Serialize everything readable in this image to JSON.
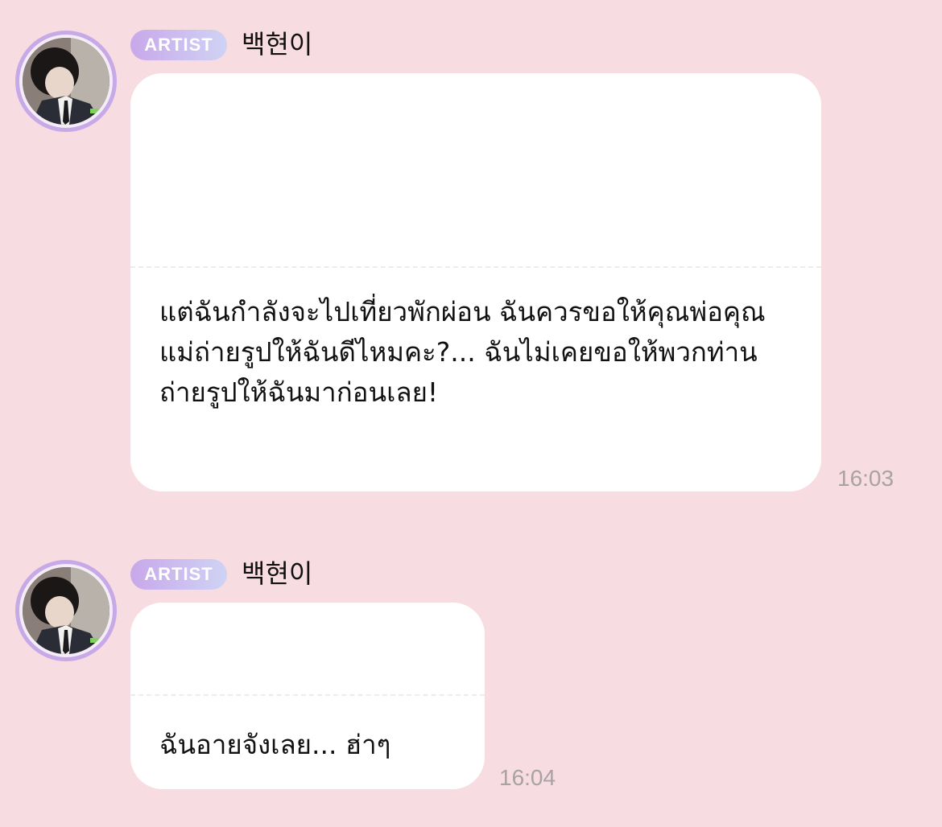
{
  "messages": [
    {
      "badge": "ARTIST",
      "sender": "백현이",
      "text": "แต่ฉันกำลังจะไปเที่ยวพักผ่อน ฉันควรขอให้คุณพ่อคุณแม่ถ่ายรูปให้ฉันดีไหมคะ?... ฉันไม่เคยขอให้พวกท่านถ่ายรูปให้ฉันมาก่อนเลย!",
      "time": "16:03"
    },
    {
      "badge": "ARTIST",
      "sender": "백현이",
      "text": "ฉันอายจังเลย... ฮ่าๆ",
      "time": "16:04"
    }
  ],
  "colors": {
    "background": "#f7dce1",
    "bubble": "#ffffff",
    "badge_gradient_start": "#c8a8ea",
    "badge_gradient_end": "#cfd3f4",
    "avatar_ring": "#c6a9e6",
    "timestamp": "#a8a2a5"
  }
}
